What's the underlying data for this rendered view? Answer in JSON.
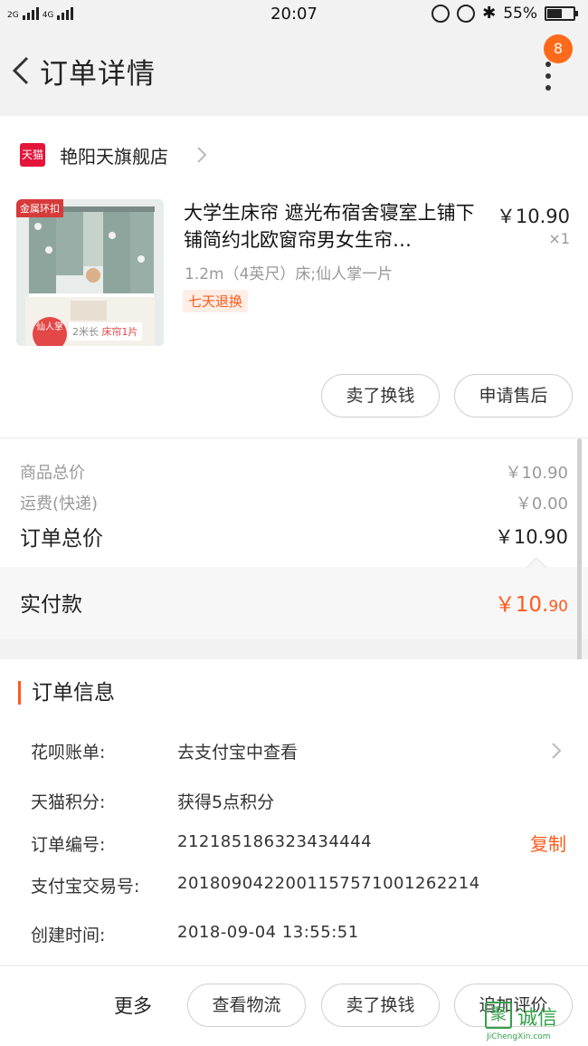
{
  "status_bar": {
    "network_left": "2G",
    "network_right": "4G",
    "time": "20:07",
    "battery": "55%"
  },
  "header": {
    "title": "订单详情",
    "badge_count": "8"
  },
  "store": {
    "logo_text": "天猫",
    "name": "艳阳天旗舰店"
  },
  "product": {
    "thumb_tag": "金属环扣",
    "thumb_badge": "仙人掌",
    "thumb_strip_length": "2米长",
    "thumb_strip_count": "床帘1片",
    "title": "大学生床帘 遮光布宿舍寝室上铺下铺简约北欧窗帘男女生帘…",
    "price": "￥10.90",
    "quantity": "×1",
    "spec": "1.2m（4英尺）床;仙人掌一片",
    "return_tag": "七天退换"
  },
  "item_actions": {
    "sell_label": "卖了换钱",
    "after_sale_label": "申请售后"
  },
  "price_summary": {
    "goods_total_label": "商品总价",
    "goods_total_value": "￥10.90",
    "shipping_label": "运费(快递)",
    "shipping_value": "￥0.00",
    "order_total_label": "订单总价",
    "order_total_value": "￥10.90",
    "paid_label": "实付款",
    "paid_currency_int": "￥10.",
    "paid_decimal": "90"
  },
  "order_info": {
    "title": "订单信息",
    "rows": [
      {
        "label": "花呗账单:",
        "value": "去支付宝中查看"
      },
      {
        "label": "天猫积分:",
        "value": "获得5点积分"
      },
      {
        "label": "订单编号:",
        "value": "212185186323434444"
      },
      {
        "label": "支付宝交易号:",
        "value": "2018090422001157571001262214"
      },
      {
        "label": "创建时间:",
        "value": "2018-09-04  13:55:51"
      }
    ],
    "copy_label": "复制"
  },
  "bottom_bar": {
    "more_label": "更多",
    "logistics_label": "查看物流",
    "sell_label": "卖了换钱",
    "review_label": "追加评价"
  },
  "watermark": {
    "mark": "聚",
    "name": "诚信",
    "url": "JiChengXin.com"
  },
  "colors": {
    "accent": "#ff5a1a",
    "tmall_red": "#e4143a",
    "badge": "#ff6a1a"
  }
}
